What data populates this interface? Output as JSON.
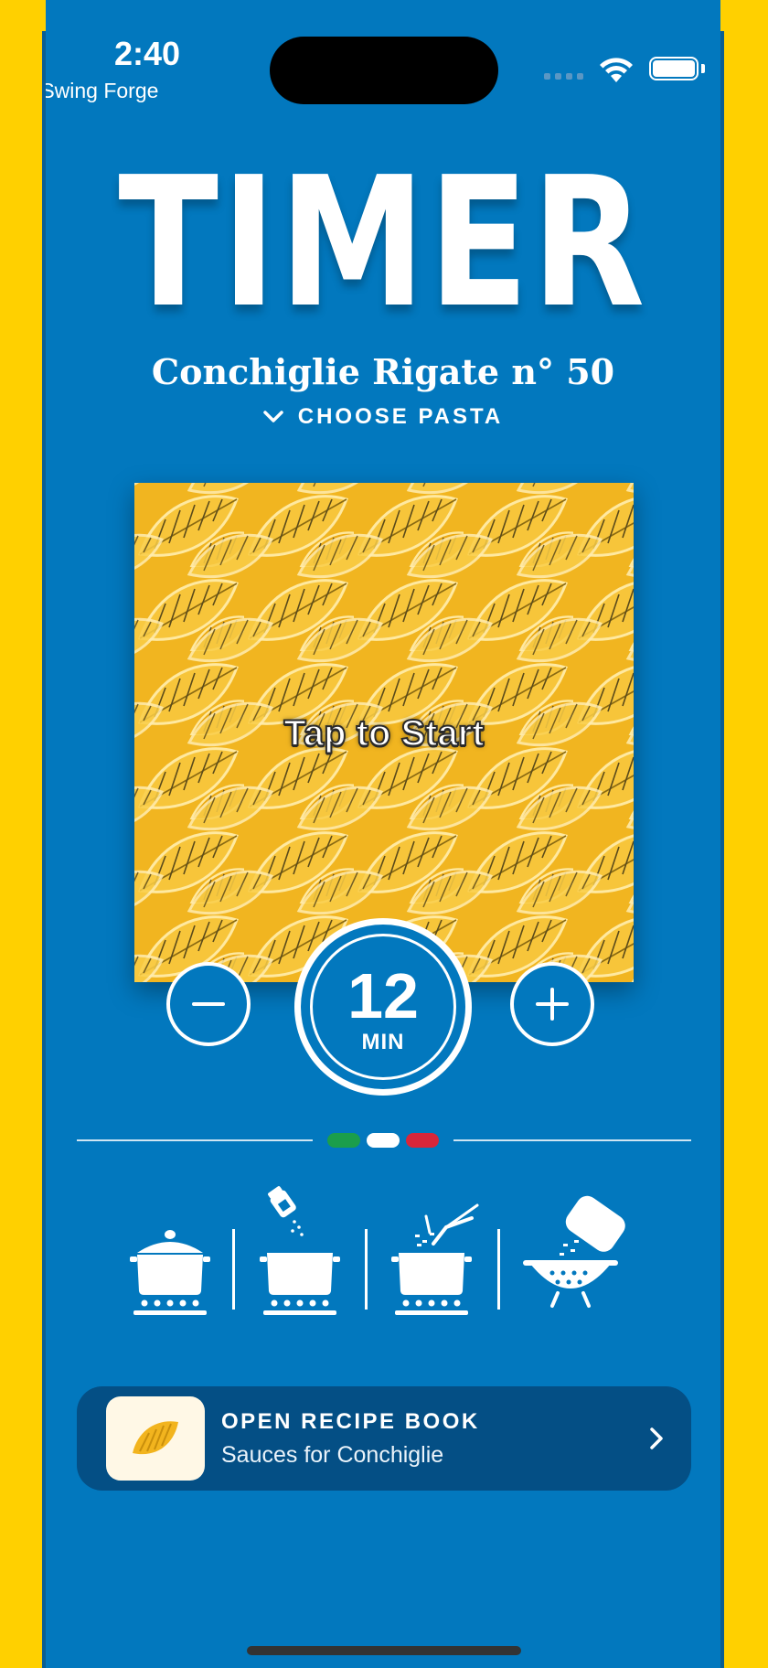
{
  "status_bar": {
    "time": "2:40",
    "back_label": "Swing Forge",
    "back_icon": "back-triangle-icon"
  },
  "header": {
    "logo_text": "TIMER",
    "pasta_name": "Conchiglie Rigate n° 50",
    "choose_label": "CHOOSE PASTA"
  },
  "pasta_tile": {
    "prompt": "Tap to Start"
  },
  "timer": {
    "value": "12",
    "unit": "MIN",
    "decrement_symbol": "−",
    "increment_symbol": "+"
  },
  "divider": {
    "flag_colors": [
      "#1B9E4B",
      "#FFFFFF",
      "#D8263A"
    ]
  },
  "steps": [
    {
      "icon": "covered-pot-icon"
    },
    {
      "icon": "salt-pot-icon"
    },
    {
      "icon": "pasta-pot-icon"
    },
    {
      "icon": "colander-icon"
    }
  ],
  "recipe": {
    "title": "OPEN RECIPE BOOK",
    "subtitle": "Sauces for Conchiglie"
  },
  "colors": {
    "background": "#0278BE",
    "frame": "#FFD000",
    "recipe_bg": "#044F85",
    "pasta": "#F2B41E"
  }
}
